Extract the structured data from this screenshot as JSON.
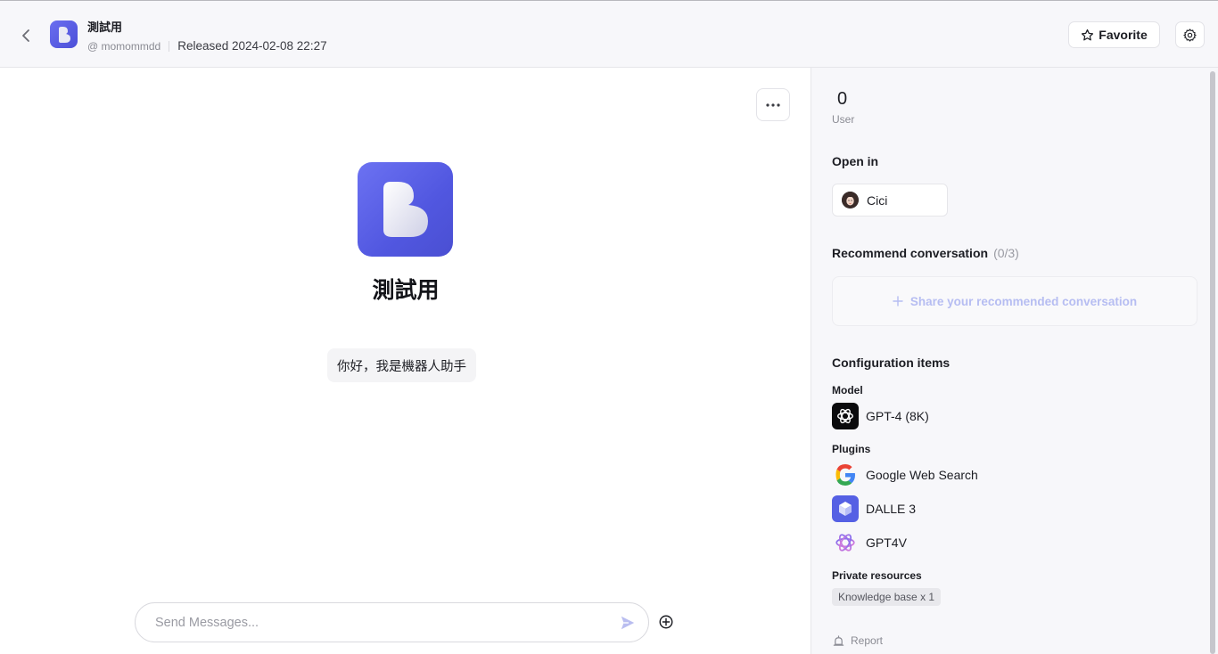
{
  "header": {
    "bot_name": "測試用",
    "author": "@ momommdd",
    "released": "Released 2024-02-08 22:27",
    "favorite_label": "Favorite"
  },
  "main": {
    "bot_title": "測試用",
    "greeting": "你好，我是機器人助手",
    "input_placeholder": "Send Messages..."
  },
  "sidebar": {
    "user_count": "0",
    "user_label": "User",
    "open_in_title": "Open in",
    "open_in_app": "Cici",
    "recommend_title": "Recommend conversation",
    "recommend_count": "(0/3)",
    "share_label": "Share your recommended conversation",
    "config_title": "Configuration items",
    "model_label": "Model",
    "model_name": "GPT-4 (8K)",
    "plugins_label": "Plugins",
    "plugins": [
      "Google Web Search",
      "DALLE 3",
      "GPT4V"
    ],
    "private_label": "Private resources",
    "knowledge_tag": "Knowledge base x 1",
    "report_label": "Report"
  },
  "colors": {
    "accent": "#5a5fe6",
    "share_text": "#b6bdf2",
    "panel_bg": "#f7f7fa"
  },
  "icons": [
    "chevron-left-icon",
    "bot-logo-icon",
    "star-icon",
    "gear-icon",
    "ellipsis-icon",
    "send-icon",
    "plus-circle-icon",
    "plus-icon",
    "openai-icon",
    "google-icon",
    "dalle-cube-icon",
    "gpt4v-icon",
    "alarm-icon"
  ]
}
